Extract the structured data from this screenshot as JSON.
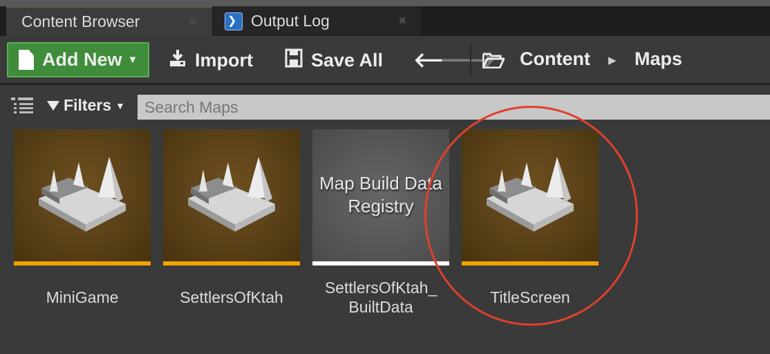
{
  "tabs": [
    {
      "label": "Content Browser",
      "close": "✖",
      "active": true
    },
    {
      "label": "Output Log",
      "close": "✖",
      "active": false
    }
  ],
  "toolbar": {
    "add_new_label": "Add New",
    "import_label": "Import",
    "save_all_label": "Save All",
    "back_icon": "arrow-left-icon",
    "forward_icon": "arrow-right-icon",
    "forward_enabled": false
  },
  "breadcrumb": {
    "items": [
      "Content",
      "Maps"
    ],
    "separator": "▶"
  },
  "filterbar": {
    "filters_label": "Filters",
    "search_placeholder": "Search Maps"
  },
  "assets": [
    {
      "name": "MiniGame",
      "type": "map",
      "bar_color": "#f2a300"
    },
    {
      "name": "SettlersOfKtah",
      "type": "map",
      "bar_color": "#f2a300"
    },
    {
      "name": "SettlersOfKtah_\nBuiltData",
      "type": "registry",
      "thumb_text": "Map Build Data Registry",
      "bar_color": "#ffffff"
    },
    {
      "name": "TitleScreen",
      "type": "map",
      "bar_color": "#f2a300",
      "highlighted": true
    }
  ],
  "colors": {
    "accent_green": "#3f8d3a",
    "map_asset_bar": "#f2a300",
    "highlight_circle": "#e0402d"
  }
}
